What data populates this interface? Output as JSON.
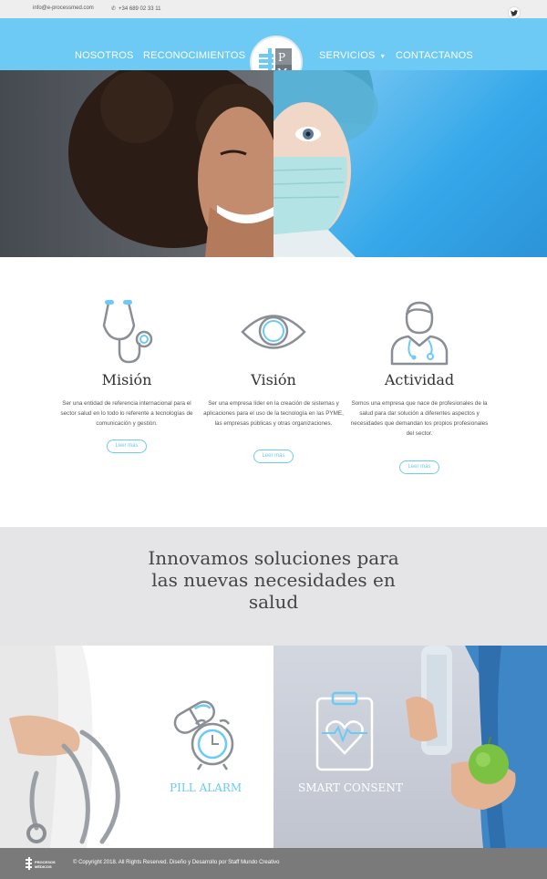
{
  "topbar": {
    "email": "info@e-processmed.com",
    "phone": "+34 689 02 33 11",
    "phone_icon": "phone-icon",
    "social_icon": "twitter-icon"
  },
  "nav": {
    "items": [
      "NOSOTROS",
      "RECONOCIMIENTOS",
      "SERVICIOS",
      "CONTACTANOS"
    ],
    "dropdown_icon": "▾",
    "logo_letters": "EPM"
  },
  "cards": [
    {
      "icon": "stethoscope-icon",
      "title": "Misión",
      "text": "Ser una entidad de referencia internacional para el sector salud en lo todo lo referente a tecnologías de comunicación y gestión.",
      "button": "Leer más"
    },
    {
      "icon": "eye-icon",
      "title": "Visión",
      "text": "Ser una empresa líder en la creación de sistemas y aplicaciones para el uso de la tecnología en las PYME, las empresas públicas y otras organizaciones.",
      "button": "Leer más"
    },
    {
      "icon": "doctor-icon",
      "title": "Actividad",
      "text": "Somos una empresa que nace de profesionales de la salud para dar solución a diferentes aspectos y necesidades que demandan los propios profesionales del sector.",
      "button": "Leer más"
    }
  ],
  "band": {
    "tagline": "Innovamos soluciones para las nuevas necesidades en salud"
  },
  "products": [
    {
      "icon": "pill-alarm-icon",
      "label": "PILL ALARM"
    },
    {
      "icon": "clipboard-heart-icon",
      "label": "SMART CONSENT"
    }
  ],
  "footer": {
    "logo_text": "PROCESOS MÉDICOS",
    "copyright": "© Copyright 2018. All Rights Reserved. Diseño y Desarrollo por Staff Mundo Creativo"
  },
  "colors": {
    "accent": "#6ccaf5",
    "icon_gray": "#8a8f96",
    "footer": "#7a7a7a",
    "band": "#e5e5e8"
  }
}
